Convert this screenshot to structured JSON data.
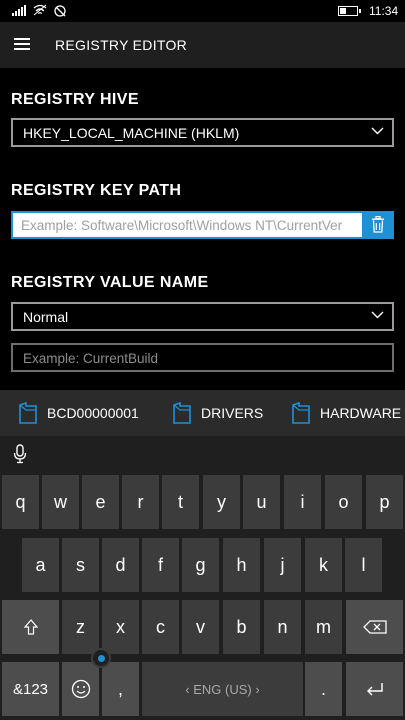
{
  "status": {
    "time": "11:34"
  },
  "app": {
    "title": "REGISTRY EDITOR"
  },
  "form": {
    "hive_label": "REGISTRY HIVE",
    "hive_value": "HKEY_LOCAL_MACHINE (HKLM)",
    "key_path_label": "REGISTRY KEY PATH",
    "key_path_placeholder": "Example: Software\\Microsoft\\Windows NT\\CurrentVer",
    "value_name_label": "REGISTRY VALUE NAME",
    "value_type": "Normal",
    "value_name_placeholder": "Example: CurrentBuild"
  },
  "suggestions": [
    "BCD00000001",
    "DRIVERS",
    "HARDWARE"
  ],
  "keyboard": {
    "row1": [
      "q",
      "w",
      "e",
      "r",
      "t",
      "y",
      "u",
      "i",
      "o",
      "p"
    ],
    "row2": [
      "a",
      "s",
      "d",
      "f",
      "g",
      "h",
      "j",
      "k",
      "l"
    ],
    "row3": [
      "z",
      "x",
      "c",
      "v",
      "b",
      "n",
      "m"
    ],
    "numbers_key": "&123",
    "comma_key": ",",
    "space_label": "ENG (US)",
    "period_key": "."
  },
  "icons": [
    "hamburger-icon",
    "chevron-down-icon",
    "trash-icon",
    "folder-icon",
    "microphone-icon",
    "shift-icon",
    "backspace-icon",
    "emoji-icon",
    "enter-icon"
  ],
  "colors": {
    "accent": "#1e90d6",
    "appbar": "#1f1f1f",
    "key": "#3c3c3c"
  }
}
